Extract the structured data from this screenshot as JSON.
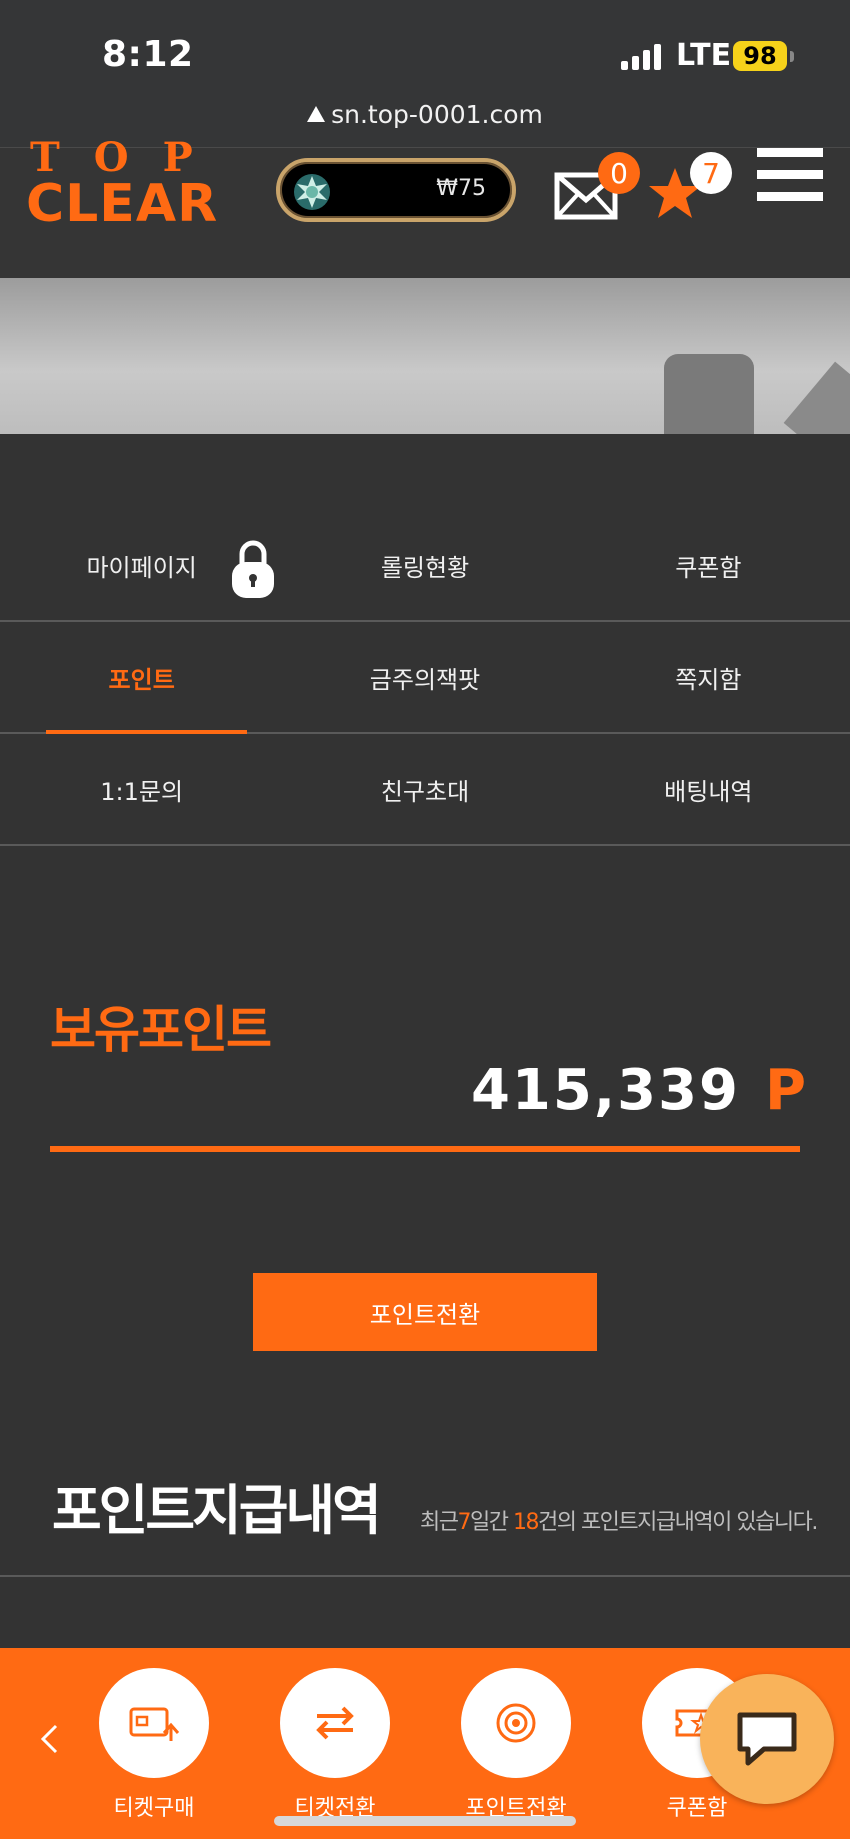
{
  "status_bar": {
    "time": "8:12",
    "network": "LTE",
    "battery": "98",
    "url": "sn.top-0001.com"
  },
  "header": {
    "logo_top": "TOP",
    "logo_main": "CLEAR",
    "balance": "₩75",
    "mail_count": "0",
    "favorites_count": "7"
  },
  "menu": {
    "rows": [
      [
        "마이페이지",
        "롤링현황",
        "쿠폰함"
      ],
      [
        "포인트",
        "금주의잭팟",
        "쪽지함"
      ],
      [
        "1:1문의",
        "친구초대",
        "배팅내역"
      ]
    ],
    "active": "포인트"
  },
  "points": {
    "title": "보유포인트",
    "value": "415,339",
    "unit": "P",
    "convert_button": "포인트전환"
  },
  "history": {
    "title": "포인트지급내역",
    "note_prefix": "최근",
    "note_days": "7",
    "note_mid": "일간 ",
    "note_count": "18",
    "note_suffix": "건의 포인트지급내역이 있습니다."
  },
  "bottom_bar": {
    "items": [
      "티켓구매",
      "티켓전환",
      "포인트전환",
      "쿠폰함"
    ]
  },
  "colors": {
    "accent": "#ff6a13",
    "background": "#333333"
  }
}
